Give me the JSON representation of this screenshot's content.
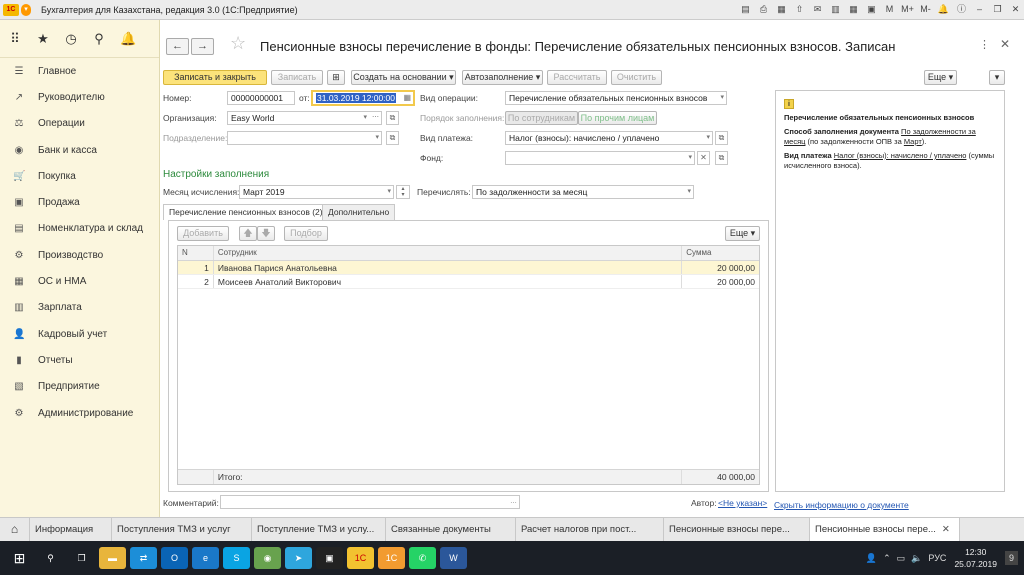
{
  "window": {
    "title": "Бухгалтерия для Казахстана, редакция 3.0  (1С:Предприятие)",
    "logo": "1С"
  },
  "sidebar": {
    "items": [
      {
        "icon": "☰",
        "label": "Главное"
      },
      {
        "icon": "↗",
        "label": "Руководителю"
      },
      {
        "icon": "⚖",
        "label": "Операции"
      },
      {
        "icon": "◉",
        "label": "Банк и касса"
      },
      {
        "icon": "🛒",
        "label": "Покупка"
      },
      {
        "icon": "▣",
        "label": "Продажа"
      },
      {
        "icon": "▤",
        "label": "Номенклатура и склад"
      },
      {
        "icon": "⚙",
        "label": "Производство"
      },
      {
        "icon": "▦",
        "label": "ОС и НМА"
      },
      {
        "icon": "▥",
        "label": "Зарплата"
      },
      {
        "icon": "👤",
        "label": "Кадровый учет"
      },
      {
        "icon": "▮",
        "label": "Отчеты"
      },
      {
        "icon": "▧",
        "label": "Предприятие"
      },
      {
        "icon": "⚙",
        "label": "Администрирование"
      }
    ]
  },
  "header": {
    "back": "←",
    "forward": "→",
    "title": "Пенсионные взносы перечисление в фонды: Перечисление обязательных пенсионных взносов. Записан"
  },
  "toolbar": {
    "save_close": "Записать и закрыть",
    "save": "Записать",
    "create_based": "Создать на основании",
    "autofill": "Автозаполнение",
    "calculate": "Рассчитать",
    "clear": "Очистить",
    "more": "Еще"
  },
  "form": {
    "number_label": "Номер:",
    "number_value": "00000000001",
    "from_label": "от:",
    "date_value": "31.03.2019 12:00:00",
    "org_label": "Организация:",
    "org_value": "Easy World",
    "dept_label": "Подразделение:",
    "dept_value": "",
    "op_type_label": "Вид операции:",
    "op_type_value": "Перечисление обязательных пенсионных взносов",
    "fill_order_label": "Порядок заполнения:",
    "fill_by_employees": "По сотрудникам",
    "fill_by_others": "По прочим лицам",
    "payment_type_label": "Вид платежа:",
    "payment_type_value": "Налог (взносы): начислено / уплачено",
    "fund_label": "Фонд:",
    "fund_value": "",
    "fill_settings": "Настройки заполнения",
    "month_label": "Месяц исчисления:",
    "month_value": "Март 2019",
    "transfer_label": "Перечислять:",
    "transfer_value": "По задолженности за месяц",
    "comment_label": "Комментарий:",
    "author_label": "Автор:",
    "author_value": "<Не указан>",
    "hide_info": "Скрыть информацию о документе"
  },
  "tabs": {
    "contributions": "Перечисление пенсионных взносов (2)",
    "additional": "Дополнительно"
  },
  "grid": {
    "add": "Добавить",
    "select": "Подбор",
    "more": "Еще",
    "columns": {
      "n": "N",
      "employee": "Сотрудник",
      "sum": "Сумма"
    },
    "rows": [
      {
        "n": "1",
        "employee": "Иванова Парися Анатольевна",
        "sum": "20 000,00"
      },
      {
        "n": "2",
        "employee": "Моисеев Анатолий Викторович",
        "sum": "20 000,00"
      }
    ],
    "total_label": "Итого:",
    "total_value": "40 000,00"
  },
  "info_panel": {
    "heading": "Перечисление обязательных пенсионных взносов",
    "method_label": "Способ заполнения документа",
    "method_link": "По задолженности за месяц",
    "method_rest": "(по задолженности ОПВ за",
    "method_link2": "Март",
    "method_end": ").",
    "payment_label": "Вид платежа",
    "payment_link": "Налог (взносы): начислено / уплачено",
    "payment_rest": "(суммы исчисленного взноса)."
  },
  "window_tabs": [
    {
      "label": "Информация",
      "active": false
    },
    {
      "label": "Поступления ТМЗ и услуг",
      "active": false
    },
    {
      "label": "Поступление ТМЗ и услу...",
      "active": false
    },
    {
      "label": "Связанные документы",
      "active": false
    },
    {
      "label": "Расчет налогов при пост...",
      "active": false
    },
    {
      "label": "Пенсионные взносы пере...",
      "active": false
    },
    {
      "label": "Пенсионные взносы пере...",
      "active": true
    }
  ],
  "taskbar": {
    "lang": "РУС",
    "time": "12:30",
    "date": "25.07.2019",
    "notif": "9"
  }
}
